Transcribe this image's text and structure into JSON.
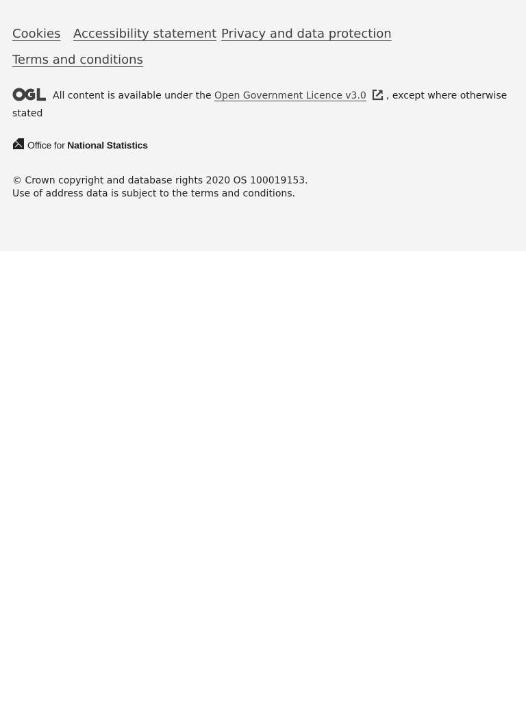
{
  "footer": {
    "links": [
      {
        "label": "Cookies"
      },
      {
        "label": "Accessibility statement"
      },
      {
        "label": "Privacy and data protection"
      },
      {
        "label": "Terms and conditions"
      }
    ],
    "licence": {
      "prefix": "All content is available under the",
      "link_label": "Open Government Licence v3.0",
      "suffix": ", except where otherwise stated",
      "logo_icon": "ogl-logo-icon",
      "external_icon": "external-link-icon"
    },
    "ons_logo": {
      "prefix": "Office for",
      "name": "National Statistics",
      "icon": "ons-logo-icon"
    },
    "copyright": {
      "line1": "© Crown copyright and database rights 2020 OS 100019153.",
      "line2": "Use of address data is subject to the terms and conditions."
    }
  },
  "colors": {
    "footer_background": "#f4f4f4",
    "page_background": "#ffffff",
    "link": "#414042",
    "text": "#222222"
  }
}
